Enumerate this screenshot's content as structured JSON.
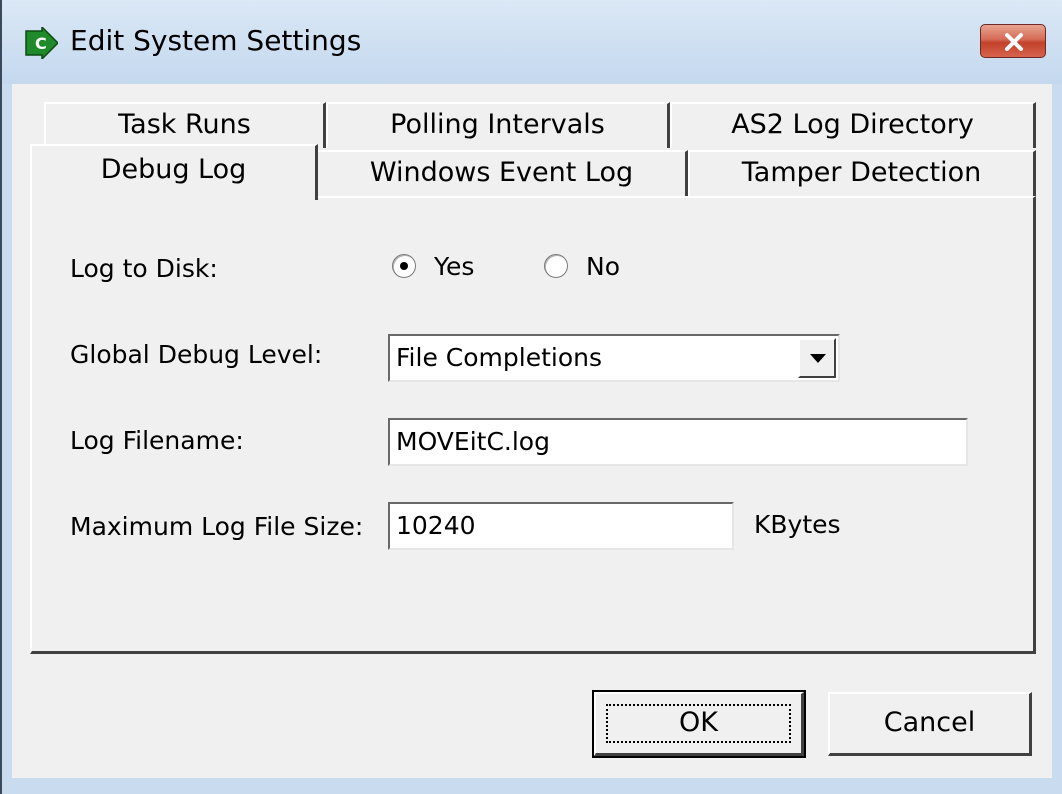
{
  "window": {
    "title": "Edit System Settings",
    "app_icon": "green-arrow-c-icon",
    "close_icon": "close-icon"
  },
  "tabs": {
    "back_row": [
      {
        "label": "Task Runs"
      },
      {
        "label": "Polling Intervals"
      },
      {
        "label": "AS2 Log Directory"
      }
    ],
    "front_row": [
      {
        "label": "Debug Log",
        "selected": true
      },
      {
        "label": "Windows Event Log",
        "selected": false
      },
      {
        "label": "Tamper Detection",
        "selected": false
      }
    ]
  },
  "form": {
    "log_to_disk": {
      "label": "Log to Disk:",
      "options": [
        {
          "label": "Yes",
          "checked": true
        },
        {
          "label": "No",
          "checked": false
        }
      ]
    },
    "global_debug_level": {
      "label": "Global Debug Level:",
      "value": "File Completions"
    },
    "log_filename": {
      "label": "Log Filename:",
      "value": "MOVEitC.log"
    },
    "max_log_file_size": {
      "label": "Maximum Log File Size:",
      "value": "10240",
      "unit": "KBytes"
    }
  },
  "buttons": {
    "ok": "OK",
    "cancel": "Cancel"
  },
  "colors": {
    "titlebar": "#c4d8ee",
    "close_button": "#c2412a",
    "app_icon": "#1f8a2a",
    "face": "#f0f0f0"
  }
}
